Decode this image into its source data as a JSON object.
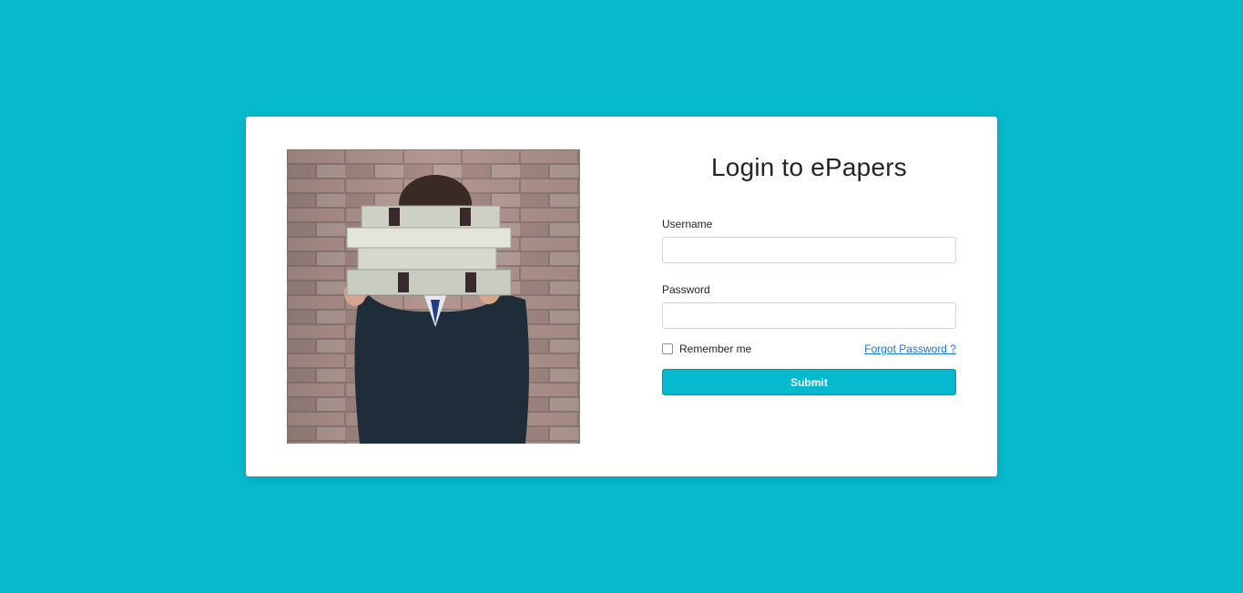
{
  "login": {
    "title": "Login to ePapers",
    "username_label": "Username",
    "username_value": "",
    "password_label": "Password",
    "password_value": "",
    "remember_label": "Remember me",
    "remember_checked": false,
    "forgot_label": "Forgot Password ?",
    "submit_label": "Submit"
  },
  "image": {
    "description_icon": "person-holding-books-photo"
  },
  "colors": {
    "background": "#06b9cc",
    "card": "#ffffff",
    "button": "#06b9cc",
    "link": "#1a73d9"
  }
}
